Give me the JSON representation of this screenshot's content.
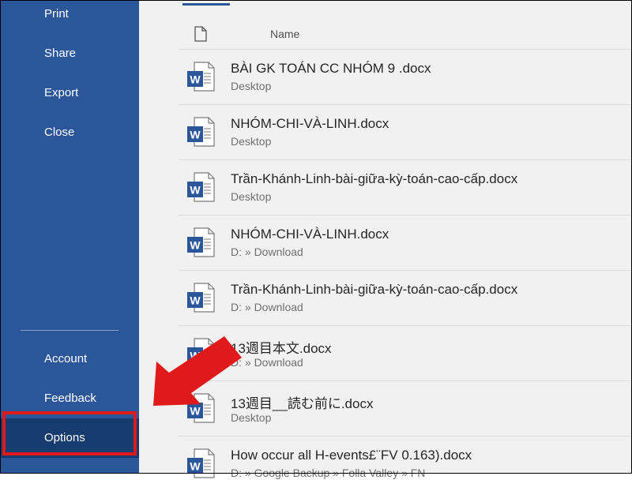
{
  "sidebar": {
    "items": [
      {
        "label": "Print"
      },
      {
        "label": "Share"
      },
      {
        "label": "Export"
      },
      {
        "label": "Close"
      }
    ],
    "bottom_items": [
      {
        "label": "Account"
      },
      {
        "label": "Feedback"
      },
      {
        "label": "Options"
      }
    ]
  },
  "file_list": {
    "header": {
      "name_label": "Name"
    },
    "files": [
      {
        "name": "BÀI GK TOÁN CC NHÓM 9 .docx",
        "location": "Desktop"
      },
      {
        "name": "NHÓM-CHI-VÀ-LINH.docx",
        "location": "Desktop"
      },
      {
        "name": "Trần-Khánh-Linh-bài-giữa-kỳ-toán-cao-cấp.docx",
        "location": "Desktop"
      },
      {
        "name": "NHÓM-CHI-VÀ-LINH.docx",
        "location": "D: » Download"
      },
      {
        "name": "Trần-Khánh-Linh-bài-giữa-kỳ-toán-cao-cấp.docx",
        "location": "D: » Download"
      },
      {
        "name": "13週目本文.docx",
        "location": "D: » Download"
      },
      {
        "name": "13週目__読む前に.docx",
        "location": "Desktop"
      },
      {
        "name": "How occur all H-events£¨FV 0.163).docx",
        "location": "D: » Google Backup » Folla Valley » FN"
      }
    ]
  },
  "colors": {
    "sidebar_bg": "#2b579a",
    "sidebar_selected": "#163b6e",
    "highlight": "#e01a1a",
    "word_blue": "#2b579a"
  },
  "icons": {
    "file_header": "document-icon",
    "file_type": "word-doc-icon",
    "annotation": "red-arrow"
  }
}
